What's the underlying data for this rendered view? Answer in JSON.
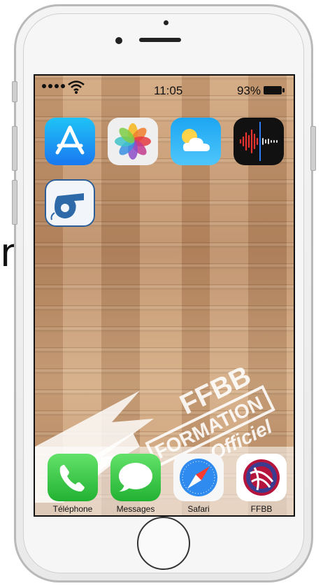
{
  "status_bar": {
    "time": "11:05",
    "battery_percent": "93%",
    "signal_dots": 4
  },
  "home_apps": [
    {
      "name": "App Store",
      "icon": "app-store-icon"
    },
    {
      "name": "Photos",
      "icon": "photos-icon"
    },
    {
      "name": "Weather",
      "icon": "weather-icon"
    },
    {
      "name": "Voice Memos",
      "icon": "voice-memos-icon"
    },
    {
      "name": "Whistle",
      "icon": "whistle-icon"
    }
  ],
  "wallpaper": {
    "watermark_line1": "FFBB",
    "watermark_line2": "FORMATION",
    "watermark_line3": "Officiel"
  },
  "dock": [
    {
      "label": "Téléphone",
      "icon": "phone-icon",
      "color": "#3ecb46"
    },
    {
      "label": "Messages",
      "icon": "messages-icon",
      "color": "#3ecb46"
    },
    {
      "label": "Safari",
      "icon": "safari-icon",
      "color": "#2f8bf0"
    },
    {
      "label": "FFBB",
      "icon": "ffbb-logo-icon",
      "color": "#b5143c"
    }
  ],
  "edge_text": "n"
}
